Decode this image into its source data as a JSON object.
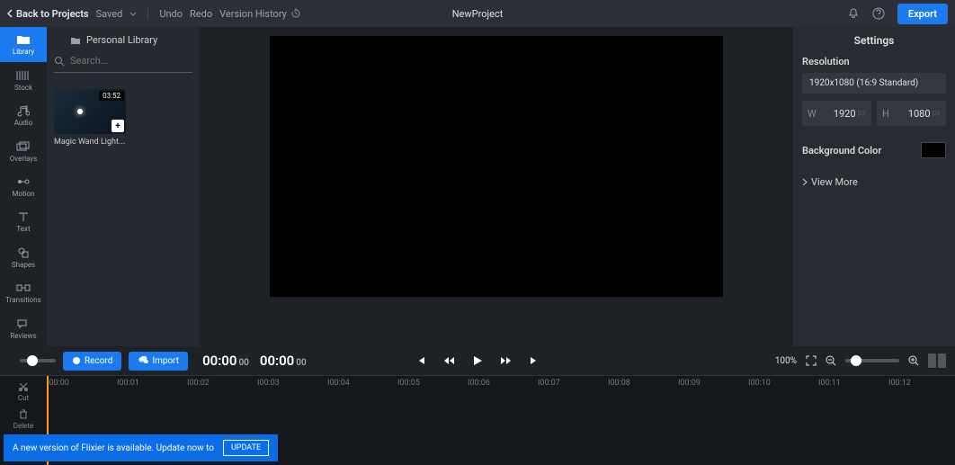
{
  "topbar": {
    "back": "Back to Projects",
    "saved": "Saved",
    "undo": "Undo",
    "redo": "Redo",
    "history": "Version History",
    "project_title": "NewProject",
    "export": "Export"
  },
  "rail": {
    "library": "Library",
    "stock": "Stock",
    "audio": "Audio",
    "overlays": "Overlays",
    "motion": "Motion",
    "text": "Text",
    "shapes": "Shapes",
    "transitions": "Transitions",
    "reviews": "Reviews"
  },
  "library": {
    "header": "Personal Library",
    "search_placeholder": "Search...",
    "clip": {
      "duration": "03:52",
      "title": "Magic Wand Light..."
    }
  },
  "transport": {
    "record": "Record",
    "import": "Import",
    "time_current": "00:00",
    "time_current_frames": "00",
    "time_duration": "00:00",
    "time_duration_frames": "00",
    "zoom_pct": "100%"
  },
  "ruler": [
    "I00:00",
    "I00:01",
    "I00:02",
    "I00:03",
    "I00:04",
    "I00:05",
    "I00:06",
    "I00:07",
    "I00:08",
    "I00:09",
    "I00:10",
    "I00:11",
    "I00:12"
  ],
  "tl_tools": {
    "cut": "Cut",
    "delete": "Delete"
  },
  "settings": {
    "title": "Settings",
    "resolution_label": "Resolution",
    "resolution_value": "1920x1080 (16:9 Standard)",
    "w_label": "W",
    "w_value": "1920",
    "w_unit": "px",
    "h_label": "H",
    "h_value": "1080",
    "h_unit": "px",
    "bg_label": "Background Color",
    "view_more": "View More"
  },
  "update": {
    "message": "A new version of Flixier is available. Update now to",
    "button": "UPDATE"
  }
}
